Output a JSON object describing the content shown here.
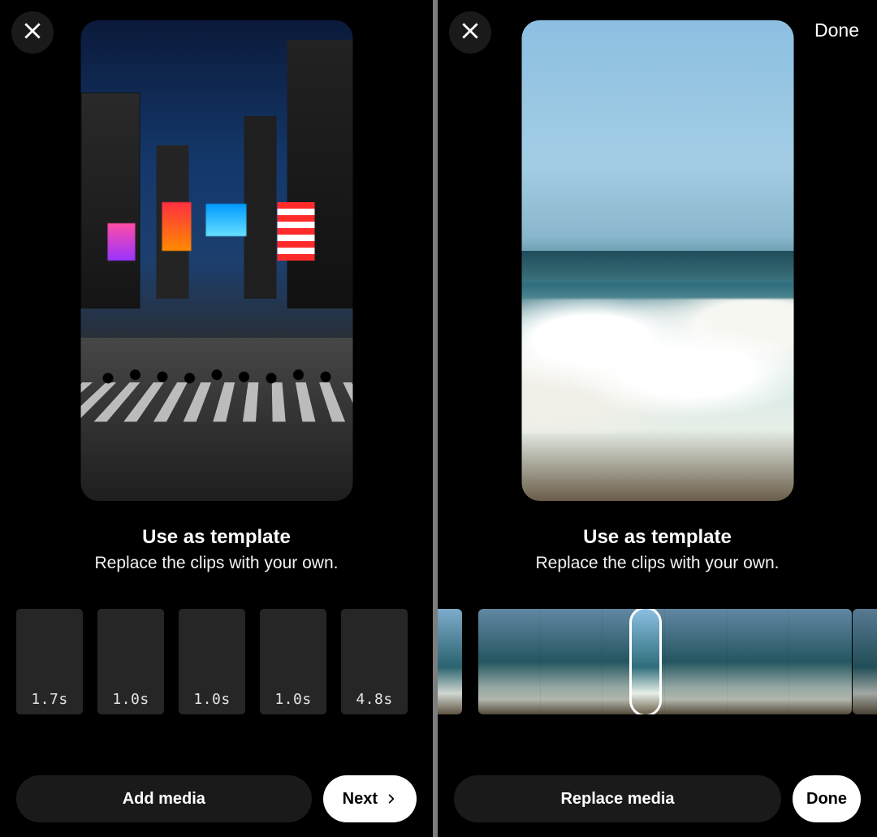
{
  "left": {
    "title": "Use as template",
    "subtitle": "Replace the clips with your own.",
    "slots": [
      "1.7s",
      "1.0s",
      "1.0s",
      "1.0s",
      "4.8s"
    ],
    "primary_label": "Add media",
    "secondary_label": "Next"
  },
  "right": {
    "done_label": "Done",
    "title": "Use as template",
    "subtitle": "Replace the clips with your own.",
    "primary_label": "Replace media",
    "secondary_label": "Done"
  }
}
